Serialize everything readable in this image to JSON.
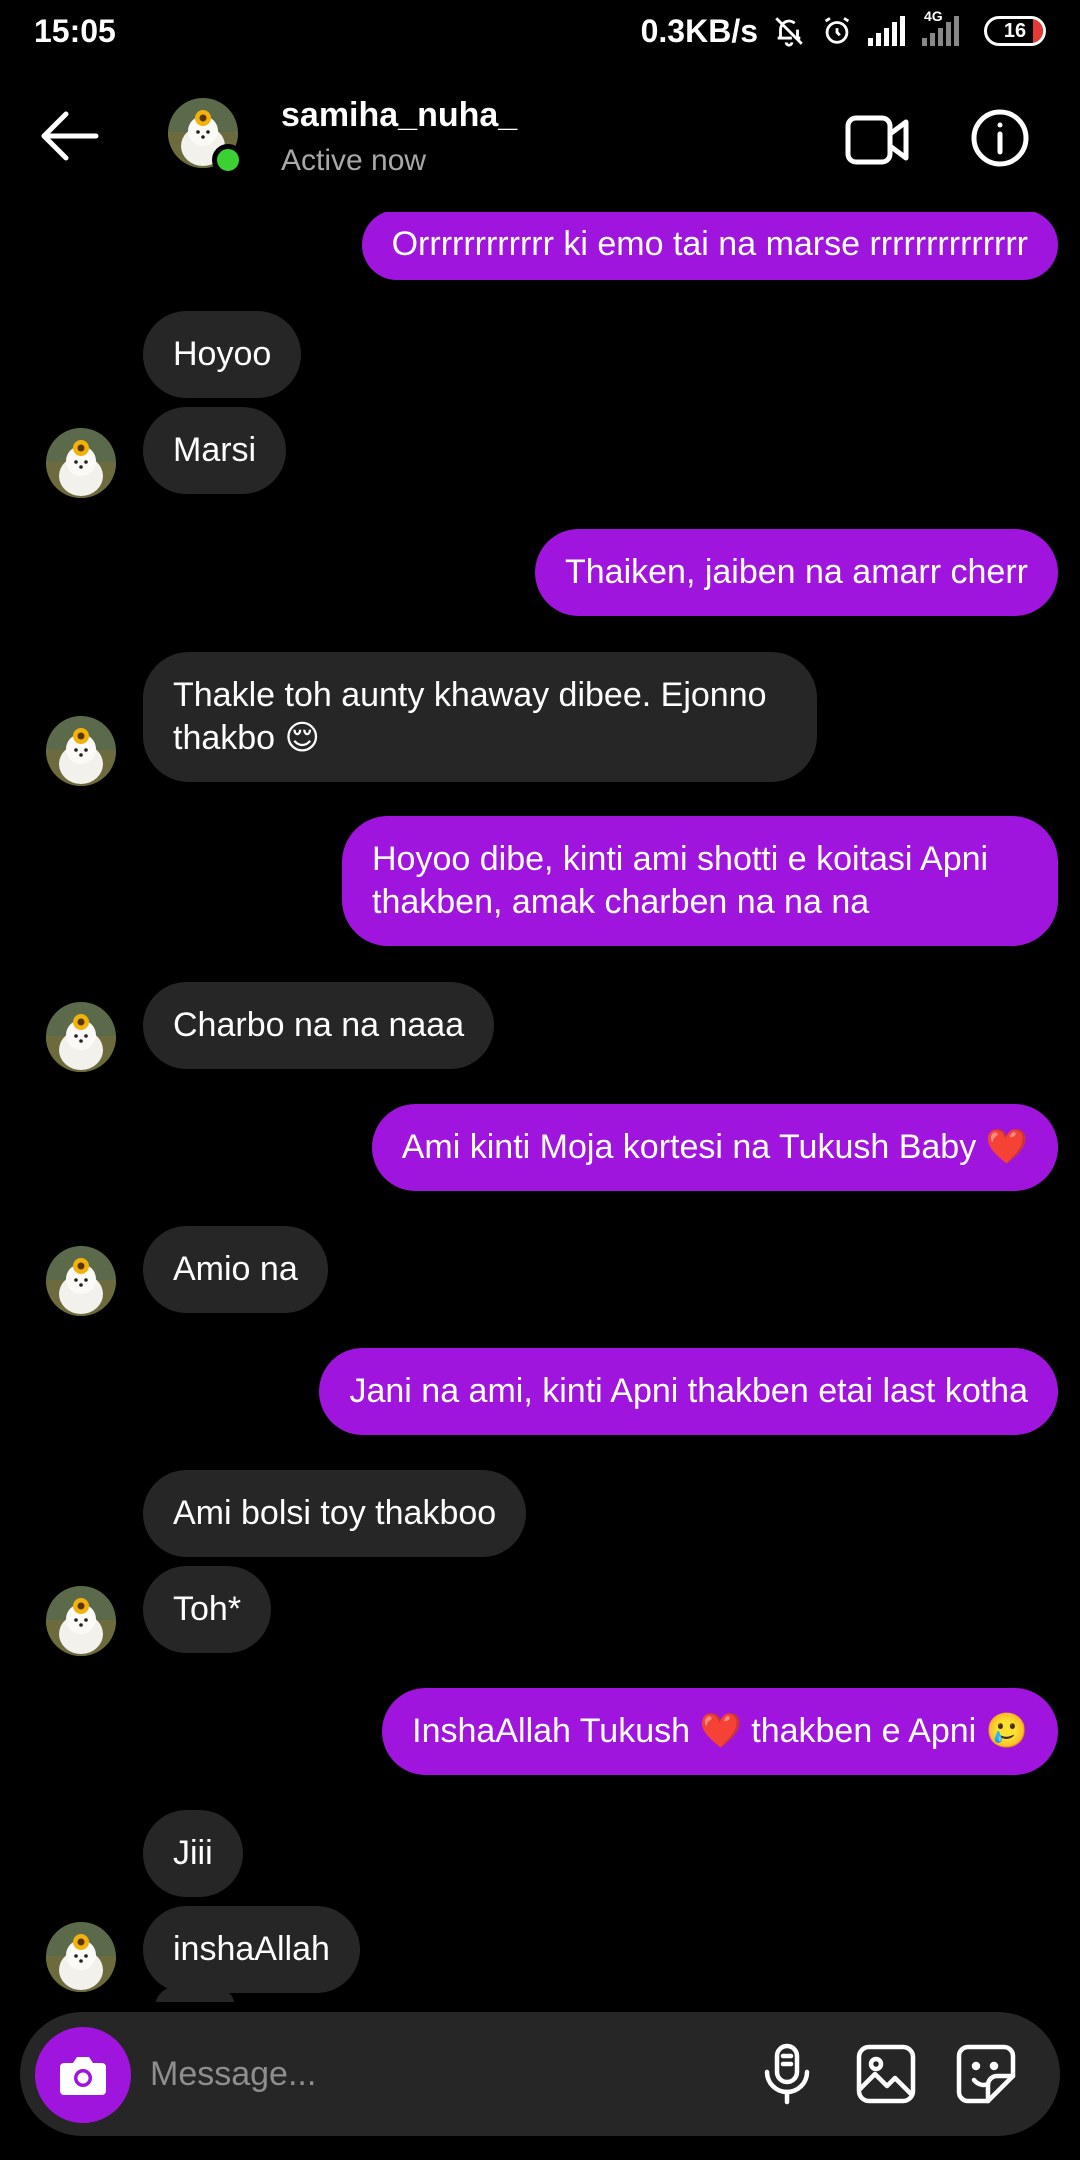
{
  "status_bar": {
    "time": "15:05",
    "network_speed": "0.3KB/s",
    "network_type": "4G",
    "battery": "16",
    "icons": [
      "mute-icon",
      "alarm-icon",
      "signal-icon",
      "signal-4g-icon",
      "battery-icon"
    ]
  },
  "header": {
    "username": "samiha_nuha_",
    "status": "Active now",
    "online_color": "#3ad133"
  },
  "theme": {
    "sent_bubble": "#a015dd",
    "received_bubble": "#262626",
    "background": "#000000"
  },
  "messages": [
    {
      "from": "me",
      "text": "Orrrrrrrrrrrr ki emo tai na marse rrrrrrrrrrrrrr"
    },
    {
      "from": "them",
      "text": "Hoyoo"
    },
    {
      "from": "them",
      "text": "Marsi"
    },
    {
      "from": "me",
      "text": "Thaiken, jaiben na amarr cherr"
    },
    {
      "from": "them",
      "text": "Thakle toh aunty khaway dibee. Ejonno\nthakbo 😌"
    },
    {
      "from": "me",
      "text": "Hoyoo dibe, kinti ami shotti e koitasi Apni\nthakben, amak charben na na na"
    },
    {
      "from": "them",
      "text": "Charbo na na naaa"
    },
    {
      "from": "me",
      "text": "Ami kinti Moja kortesi na Tukush Baby ❤️"
    },
    {
      "from": "them",
      "text": "Amio na"
    },
    {
      "from": "me",
      "text": "Jani na ami, kinti Apni thakben etai last kotha"
    },
    {
      "from": "them",
      "text": "Ami bolsi toy thakboo"
    },
    {
      "from": "them",
      "text": "Toh*"
    },
    {
      "from": "me",
      "text": "InshaAllah Tukush ❤️ thakben e Apni 🥲"
    },
    {
      "from": "them",
      "text": "Jiii"
    },
    {
      "from": "them",
      "text": "inshaAllah"
    }
  ],
  "composer": {
    "placeholder": "Message...",
    "buttons": [
      "camera-icon",
      "microphone-icon",
      "gallery-icon",
      "sticker-icon"
    ]
  }
}
